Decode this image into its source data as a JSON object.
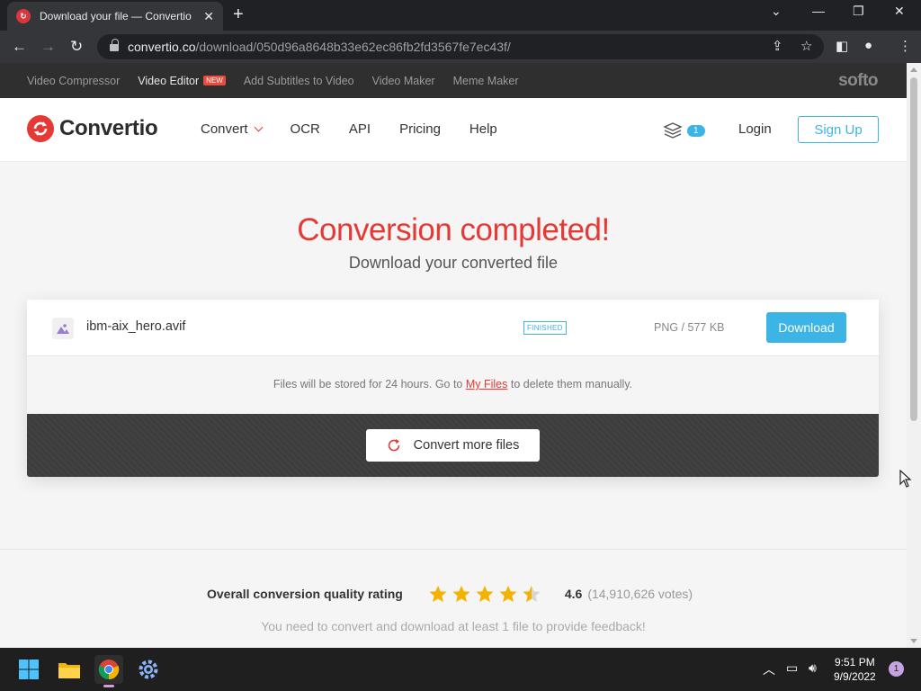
{
  "browser": {
    "tab_title": "Download your file — Convertio",
    "url_host": "convertio.co",
    "url_path": "/download/050d96a8648b33e62ec86fb2fd3567fe7ec43f/"
  },
  "promo_bar": {
    "items": [
      {
        "label": "Video Compressor"
      },
      {
        "label": "Video Editor",
        "badge": "NEW"
      },
      {
        "label": "Add Subtitles to Video"
      },
      {
        "label": "Video Maker"
      },
      {
        "label": "Meme Maker"
      }
    ],
    "brand": "softo"
  },
  "header": {
    "logo": "Convertio",
    "nav": [
      {
        "label": "Convert"
      },
      {
        "label": "OCR"
      },
      {
        "label": "API"
      },
      {
        "label": "Pricing"
      },
      {
        "label": "Help"
      }
    ],
    "files_count": "1",
    "login": "Login",
    "signup": "Sign Up"
  },
  "main": {
    "title": "Conversion completed!",
    "subtitle": "Download your converted file",
    "file": {
      "name": "ibm-aix_hero.avif",
      "status": "FINISHED",
      "meta": "PNG / 577 KB",
      "download_label": "Download"
    },
    "storage_before": "Files will be stored for 24 hours. Go to ",
    "storage_link": "My Files",
    "storage_after": " to delete them manually.",
    "convert_more": "Convert more files"
  },
  "rating": {
    "label": "Overall conversion quality rating",
    "value": "4.6",
    "votes": "(14,910,626 votes)",
    "stars": 4.5,
    "feedback": "You need to convert and download at least 1 file to provide feedback!"
  },
  "taskbar": {
    "time": "9:51 PM",
    "date": "9/9/2022",
    "notification_count": "1"
  },
  "colors": {
    "brand_red": "#e53935",
    "accent_blue": "#3cb4e5",
    "star_gold": "#f5b301"
  }
}
